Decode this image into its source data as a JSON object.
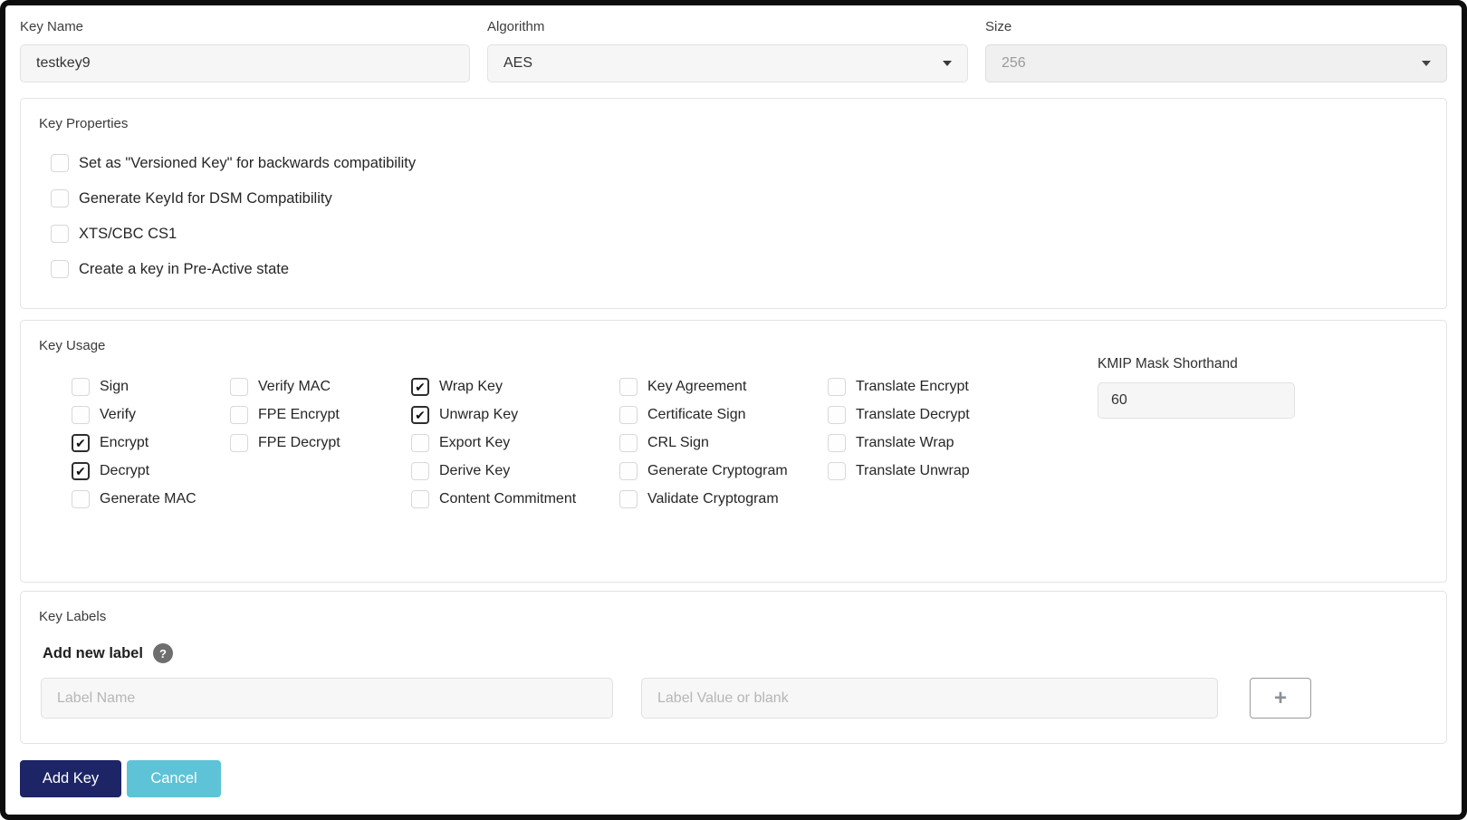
{
  "form": {
    "key_name": {
      "label": "Key Name",
      "value": "testkey9"
    },
    "algorithm": {
      "label": "Algorithm",
      "value": "AES"
    },
    "size": {
      "label": "Size",
      "value": "256",
      "disabled": true
    }
  },
  "key_properties": {
    "title": "Key Properties",
    "options": [
      {
        "label": "Set as \"Versioned Key\" for backwards compatibility",
        "checked": false
      },
      {
        "label": "Generate KeyId for DSM Compatibility",
        "checked": false
      },
      {
        "label": "XTS/CBC CS1",
        "checked": false
      },
      {
        "label": "Create a key in Pre-Active state",
        "checked": false
      }
    ]
  },
  "key_usage": {
    "title": "Key Usage",
    "columns": [
      [
        {
          "label": "Sign",
          "checked": false
        },
        {
          "label": "Verify",
          "checked": false
        },
        {
          "label": "Encrypt",
          "checked": true
        },
        {
          "label": "Decrypt",
          "checked": true
        },
        {
          "label": "Generate MAC",
          "checked": false
        }
      ],
      [
        {
          "label": "Verify MAC",
          "checked": false
        },
        {
          "label": "FPE Encrypt",
          "checked": false
        },
        {
          "label": "FPE Decrypt",
          "checked": false
        }
      ],
      [
        {
          "label": "Wrap Key",
          "checked": true
        },
        {
          "label": "Unwrap Key",
          "checked": true
        },
        {
          "label": "Export Key",
          "checked": false
        },
        {
          "label": "Derive Key",
          "checked": false
        },
        {
          "label": "Content Commitment",
          "checked": false
        }
      ],
      [
        {
          "label": "Key Agreement",
          "checked": false
        },
        {
          "label": "Certificate Sign",
          "checked": false
        },
        {
          "label": "CRL Sign",
          "checked": false
        },
        {
          "label": "Generate Cryptogram",
          "checked": false
        },
        {
          "label": "Validate Cryptogram",
          "checked": false
        }
      ],
      [
        {
          "label": "Translate Encrypt",
          "checked": false
        },
        {
          "label": "Translate Decrypt",
          "checked": false
        },
        {
          "label": "Translate Wrap",
          "checked": false
        },
        {
          "label": "Translate Unwrap",
          "checked": false
        }
      ]
    ],
    "kmip": {
      "label": "KMIP Mask Shorthand",
      "value": "60"
    }
  },
  "key_labels": {
    "title": "Key Labels",
    "add_new_label": "Add new label",
    "help_icon": "?",
    "label_name_placeholder": "Label Name",
    "label_value_placeholder": "Label Value or blank",
    "add_button": "+"
  },
  "actions": {
    "add_key": "Add Key",
    "cancel": "Cancel"
  },
  "colors": {
    "add_key_button": "#1d2566",
    "cancel_button": "#5ec3d6",
    "checkmark": "#111111"
  }
}
